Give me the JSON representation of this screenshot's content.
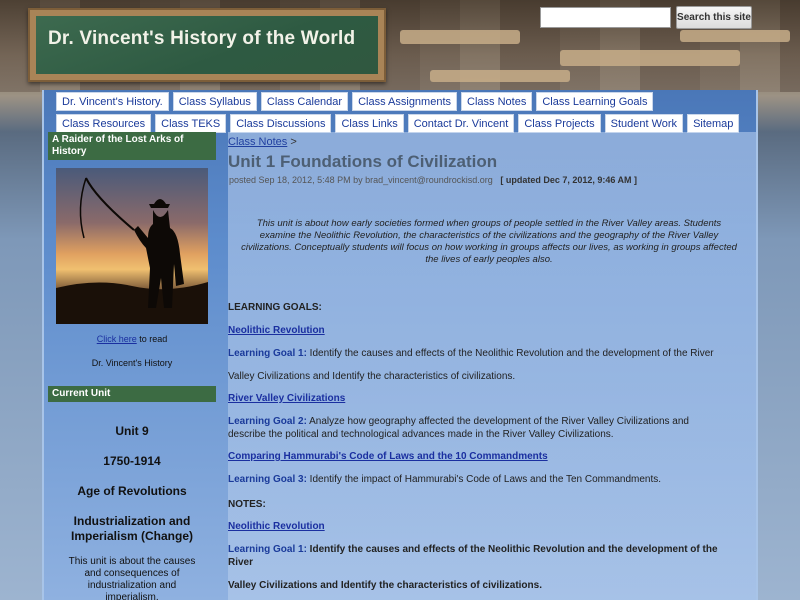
{
  "header": {
    "site_title": "Dr. Vincent's History of the World",
    "search_placeholder": "",
    "search_button": "Search this site"
  },
  "nav": {
    "row1": [
      "Dr. Vincent's History.",
      "Class Syllabus",
      "Class Calendar",
      "Class Assignments",
      "Class Notes",
      "Class Learning Goals",
      "Class Resources"
    ],
    "row2": [
      "Class TEKS",
      "Class Discussions",
      "Class Links",
      "Contact Dr. Vincent",
      "Class Projects",
      "Student Work",
      "Sitemap"
    ]
  },
  "sidebar": {
    "heading1": "A Raider of the Lost Arks of History",
    "click_link": "Click here",
    "click_suffix": " to read",
    "history_label": "Dr. Vincent's History",
    "heading2": "Current Unit",
    "unit_number": "Unit 9",
    "unit_years": "1750-1914",
    "unit_name": "Age of Revolutions",
    "unit_sub": "Industrialization and Imperialism (Change)",
    "unit_desc": "This unit is about the causes and consequences of industrialization and imperialism."
  },
  "main": {
    "breadcrumb_link": "Class Notes",
    "breadcrumb_sep": " >",
    "title": "Unit 1 Foundations of Civilization",
    "posted": "posted Sep 18, 2012, 5:48 PM by brad_vincent@roundrockisd.org",
    "updated": "[ updated Dec 7, 2012, 9:46 AM ]",
    "intro": "This unit is about how early societies formed when groups of people settled in the River Valley areas. Students examine the Neolithic Revolution, the characteristics of the civilizations and the geography of the River Valley civilizations. Conceptually students will focus on how working in groups affects our lives, as working in groups affected the lives of early peoples also.",
    "learning_goals_heading": "LEARNING GOALS:",
    "link1": "Neolithic Revolution",
    "goal1_label": "Learning Goal 1:",
    "goal1_text": " Identify the causes and effects of the Neolithic Revolution and the development of the River",
    "goal1_cont": "Valley Civilizations and Identify the characteristics of civilizations.",
    "link2": "River Valley Civilizations",
    "goal2_label": "Learning Goal 2:",
    "goal2_text": " Analyze how geography affected the development of the River Valley Civilizations and",
    "goal2_cont": "describe the political and technological advances made in the River Valley Civilizations.",
    "link3": "Comparing Hammurabi's Code of Laws and the 10 Commandments",
    "goal3_label": "Learning Goal 3:",
    "goal3_text": " Identify the impact of Hammurabi's Code of Laws and the Ten Commandments.",
    "notes_heading": "NOTES:",
    "link4": "Neolithic Revolution",
    "notes_goal_label": "Learning Goal 1:",
    "notes_goal_text": " Identify the causes and effects of the Neolithic Revolution and the development of the",
    "notes_goal_text2": "River",
    "notes_goal_cont": "Valley Civilizations and Identify the characteristics of civilizations."
  },
  "colors": {
    "chalkboard": "#2e5a42",
    "sidebar_head": "#3c6b43",
    "link": "#1a2fa0",
    "title": "#4d5f74"
  }
}
